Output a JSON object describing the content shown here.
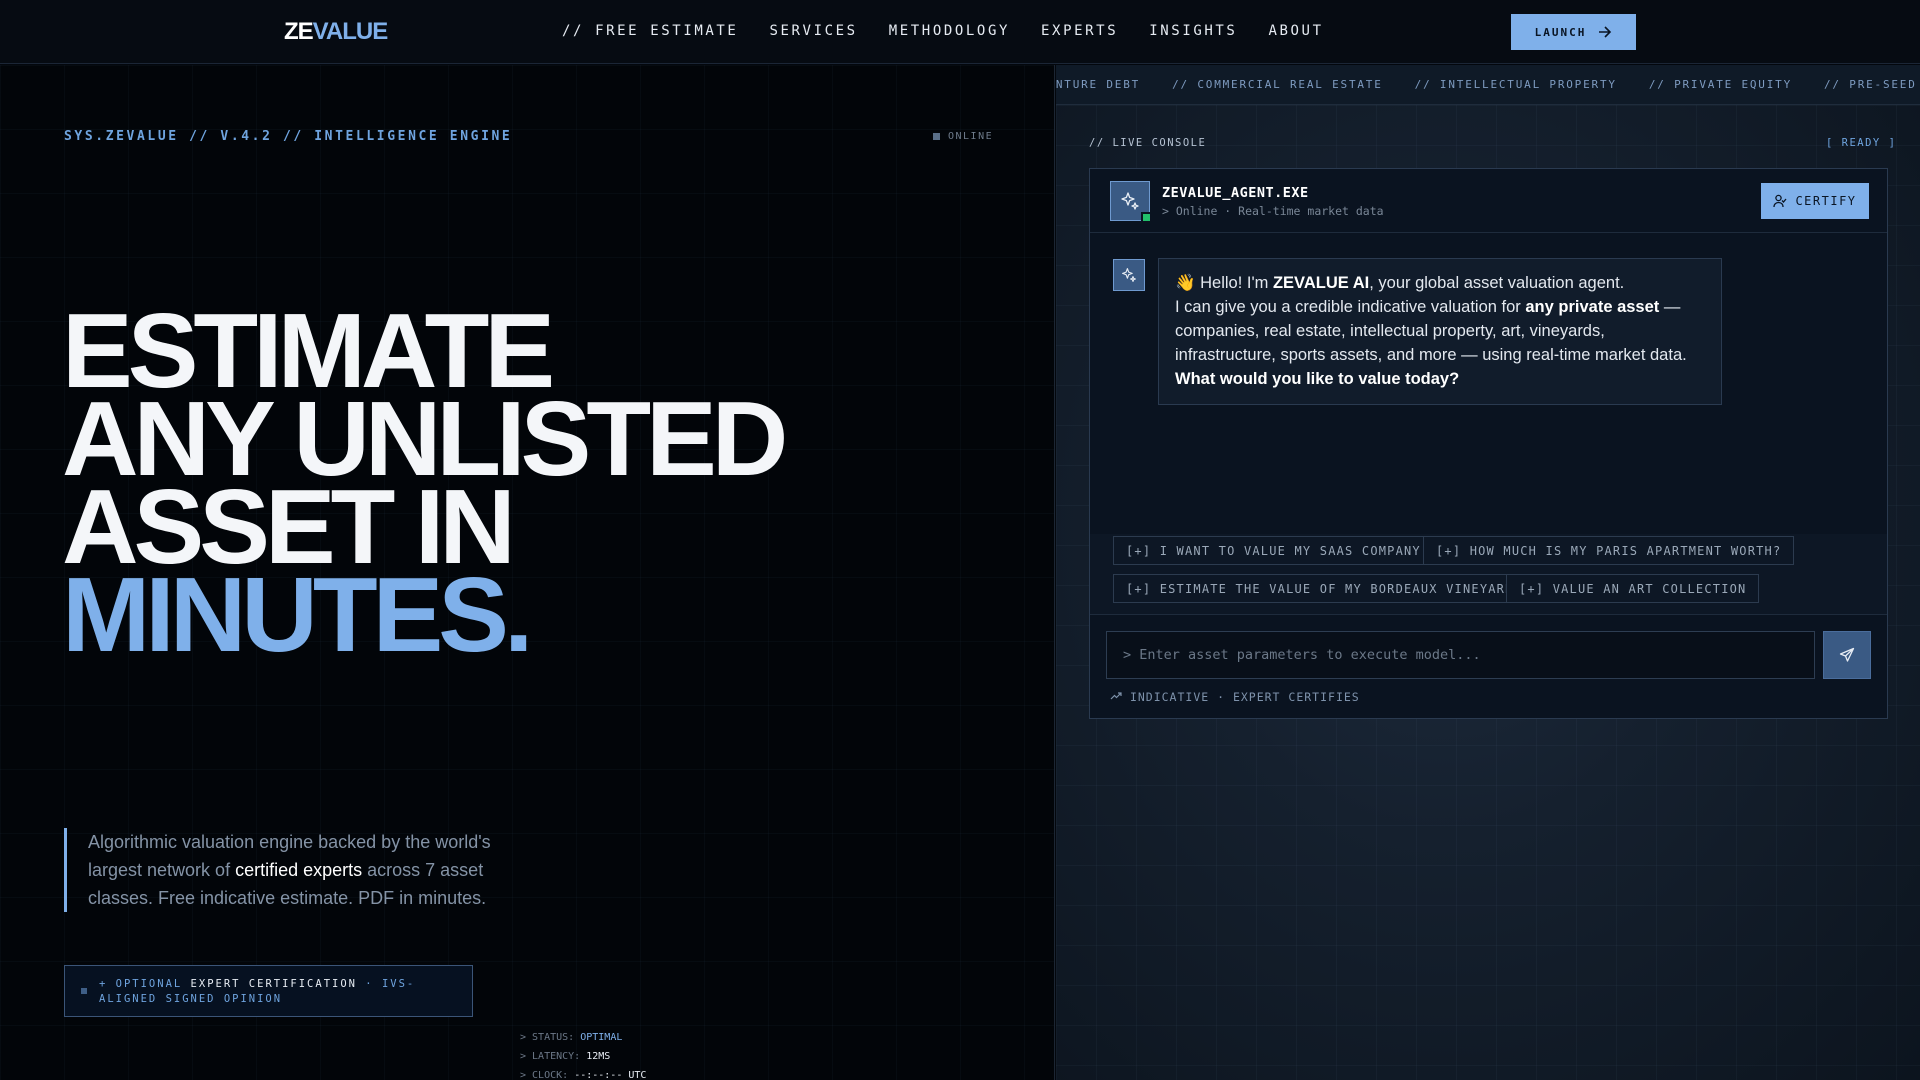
{
  "nav": {
    "logo_ze": "ZE",
    "logo_value": "VALUE",
    "links": [
      "// FREE ESTIMATE",
      "SERVICES",
      "METHODOLOGY",
      "EXPERTS",
      "INSIGHTS",
      "ABOUT"
    ],
    "launch_label": "LAUNCH"
  },
  "left": {
    "sys_label": "SYS.ZEVALUE // V.4.2 // INTELLIGENCE ENGINE",
    "online_label": "ONLINE",
    "hero": {
      "line1": "ESTIMATE",
      "line2": "ANY UNLISTED",
      "line3": "ASSET IN",
      "line4": "MINUTES."
    },
    "description": {
      "part1": "Algorithmic valuation engine backed by the world's largest network of ",
      "highlight": "certified experts",
      "part2": " across 7 asset classes. Free indicative estimate. PDF in minutes."
    },
    "optional": {
      "prefix": "+ OPTIONAL ",
      "highlight": "EXPERT CERTIFICATION",
      "suffix": " · IVS-ALIGNED SIGNED OPINION"
    },
    "status": {
      "status_label": "> STATUS: ",
      "status_value": "OPTIMAL",
      "latency_label": "> LATENCY: ",
      "latency_value": "12MS",
      "clock_label": "> CLOCK: ",
      "clock_value": "--:--:-- UTC"
    }
  },
  "right": {
    "ticker": [
      "VENTURE DEBT",
      "// COMMERCIAL REAL ESTATE",
      "// INTELLECTUAL PROPERTY",
      "// PRIVATE EQUITY",
      "// PRE-SEED SAAS"
    ],
    "console_label": "// LIVE CONSOLE",
    "ready_label": "[ READY ]",
    "agent_name": "ZEVALUE_AGENT.EXE",
    "agent_status": "> Online · Real-time market data",
    "certify_label": "CERTIFY",
    "message": {
      "greeting_pre": "👋 Hello! I'm ",
      "greeting_bold": "ZEVALUE AI",
      "greeting_post": ", your global asset valuation agent.",
      "line2_pre": "I can give you a credible indicative valuation for ",
      "line2_bold": "any private asset",
      "line2_post": " — companies, real estate, intellectual property, art, vineyards, infrastructure, sports assets, and more — using real-time market data.",
      "question": "What would you like to value today?"
    },
    "suggestions": [
      "[+] I WANT TO VALUE MY SAAS COMPANY",
      "[+] HOW MUCH IS MY PARIS APARTMENT WORTH?",
      "[+] ESTIMATE THE VALUE OF MY BORDEAUX VINEYARD",
      "[+] VALUE AN ART COLLECTION"
    ],
    "input_placeholder": "> Enter asset parameters to execute model...",
    "hint": "INDICATIVE · EXPERT CERTIFIES"
  },
  "colors": {
    "accent": "#7fb0ea",
    "background": "#03070d",
    "online_dot": "#22c06b"
  },
  "icons": {
    "launch": "arrow-right-icon",
    "agent": "sparkle-icon",
    "certify": "user-check-icon",
    "send": "send-icon",
    "hint": "trend-up-icon"
  }
}
